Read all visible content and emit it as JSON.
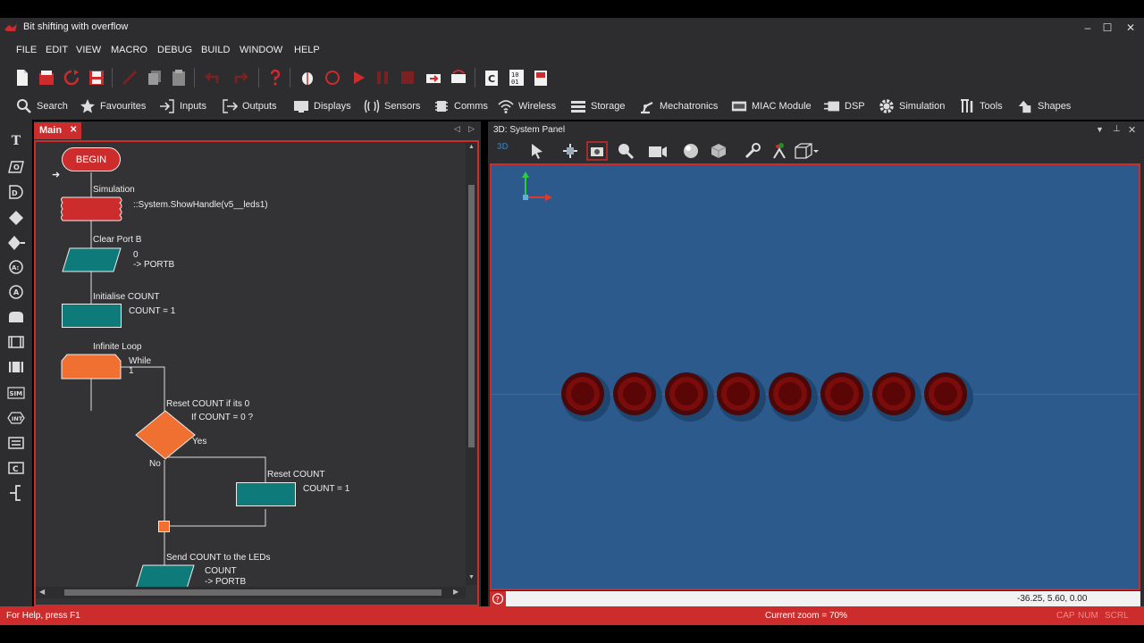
{
  "window": {
    "title": "Bit shifting with overflow",
    "minimize": "–",
    "maximize": "☐",
    "close": "✕"
  },
  "menu": [
    "FILE",
    "EDIT",
    "VIEW",
    "MACRO",
    "DEBUG",
    "BUILD",
    "WINDOW",
    "HELP"
  ],
  "components": [
    "Search",
    "Favourites",
    "Inputs",
    "Outputs",
    "Displays",
    "Sensors",
    "Comms",
    "Wireless",
    "Storage",
    "Mechatronics",
    "MIAC Module",
    "DSP",
    "Simulation",
    "Tools",
    "Shapes"
  ],
  "palette": [
    "T",
    "O",
    "D",
    "◆",
    "◆",
    "A:",
    "A",
    "",
    "",
    "",
    "SIM",
    "INT",
    "",
    "C",
    "[-"
  ],
  "flow": {
    "tab_label": "Main",
    "tab_close": "✕",
    "begin": "BEGIN",
    "sim_label": "Simulation",
    "sim_detail": "::System.ShowHandle(v5__leds1)",
    "clear_label": "Clear Port B",
    "clear_detail_1": "0",
    "clear_detail_2": "-> PORTB",
    "init_label": "Initialise COUNT",
    "init_detail": "COUNT = 1",
    "loop_label": "Infinite Loop",
    "loop_detail_1": "While",
    "loop_detail_2": "1",
    "decision_label": "Reset COUNT if its 0",
    "decision_detail": "If  COUNT = 0 ?",
    "yes": "Yes",
    "no": "No",
    "reset_label": "Reset COUNT",
    "reset_detail": "COUNT = 1",
    "send_label": "Send COUNT to the LEDs",
    "send_detail_1": "COUNT",
    "send_detail_2": "-> PORTB"
  },
  "system_panel": {
    "title": "3D: System Panel",
    "mode_label": "3D",
    "coords": "-36.25, 5.60, 0.00",
    "led_count": 8,
    "colors": {
      "background": "#2d5a8c",
      "led": "#7a0c0c"
    }
  },
  "status": {
    "help": "For Help, press F1",
    "zoom": "Current zoom = 70%",
    "cap": "CAP",
    "num": "NUM",
    "scrl": "SCRL"
  },
  "colors": {
    "accent": "#cc2c2c",
    "teal": "#0e7a7a",
    "orange": "#f07032",
    "chrome": "#2d2d30"
  }
}
